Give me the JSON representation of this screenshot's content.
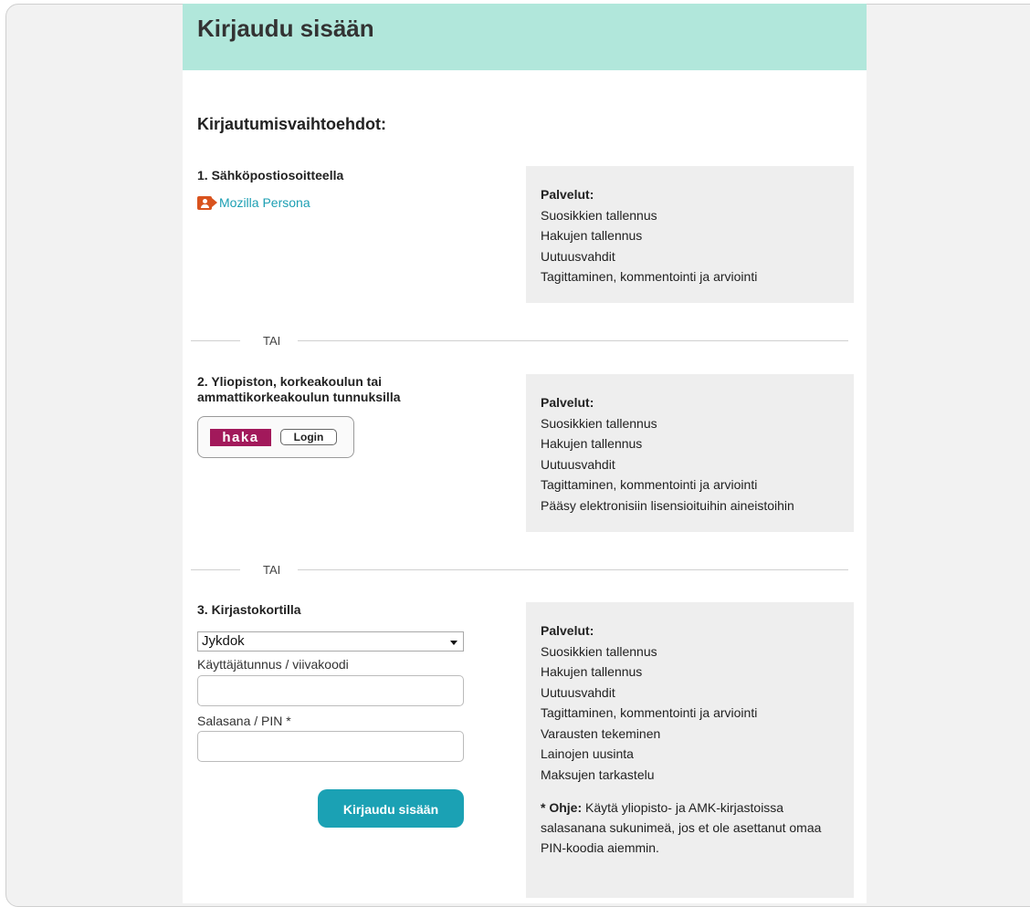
{
  "header": {
    "title": "Kirjaudu sisään"
  },
  "section_title": "Kirjautumisvaihtoehdot:",
  "option1": {
    "title": "1. Sähköpostiosoitteella",
    "persona_link": "Mozilla Persona",
    "services_title": "Palvelut:",
    "services": [
      "Suosikkien tallennus",
      "Hakujen tallennus",
      "Uutuusvahdit",
      "Tagittaminen, kommentointi ja arviointi"
    ]
  },
  "divider_text": "TAI",
  "option2": {
    "title_line1": "2. Yliopiston, korkeakoulun tai",
    "title_line2": "ammattikorkeakoulun tunnuksilla",
    "haka_logo": "haka",
    "haka_login": "Login",
    "services_title": "Palvelut:",
    "services": [
      "Suosikkien tallennus",
      "Hakujen tallennus",
      "Uutuusvahdit",
      "Tagittaminen, kommentointi ja arviointi",
      "Pääsy elektronisiin lisensioituihin aineistoihin"
    ]
  },
  "option3": {
    "title": "3. Kirjastokortilla",
    "library_select": "Jykdok",
    "username_label": "Käyttäjätunnus / viivakoodi",
    "username_value": "",
    "password_label": "Salasana / PIN *",
    "password_value": "",
    "submit_label": "Kirjaudu sisään",
    "services_title": "Palvelut:",
    "services": [
      "Suosikkien tallennus",
      "Hakujen tallennus",
      "Uutuusvahdit",
      "Tagittaminen, kommentointi ja arviointi",
      "Varausten tekeminen",
      "Lainojen uusinta",
      "Maksujen tarkastelu"
    ],
    "help_label": "* Ohje:",
    "help_text": "Käytä yliopisto- ja AMK-kirjastoissa salasanana sukunimeä, jos et ole asettanut omaa PIN-koodia aiemmin."
  },
  "colors": {
    "header_bg": "#b1e7db",
    "link": "#1c9fb3",
    "button_bg": "#1ba1b4",
    "haka_brand": "#a2195b",
    "services_bg": "#eeeeee"
  }
}
